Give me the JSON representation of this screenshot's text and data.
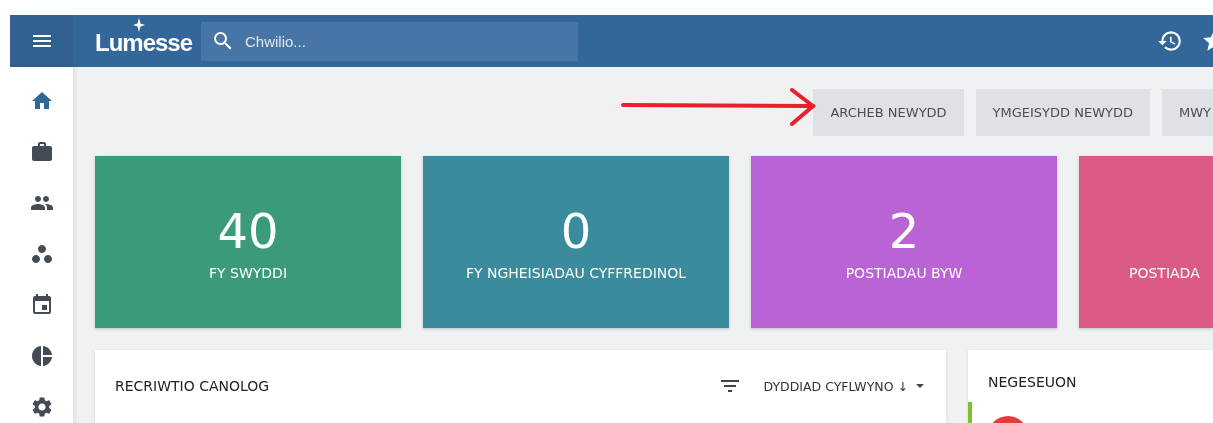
{
  "top_bar": {
    "brand": "Lumesse",
    "search": {
      "placeholder": "Chwilio..."
    }
  },
  "sidebar": {
    "items": [
      {
        "selected": true
      },
      {
        "selected": false
      },
      {
        "selected": false
      },
      {
        "selected": false
      },
      {
        "selected": false
      },
      {
        "selected": false
      },
      {
        "selected": false
      }
    ]
  },
  "actions": [
    "ARCHEB NEWYDD",
    "YMGEISYDD NEWYDD",
    "MWY"
  ],
  "tiles": [
    {
      "value": "40",
      "label": "FY SWYDDI",
      "color": "#3a9a7a"
    },
    {
      "value": "0",
      "label": "FY NGHEISIADAU CYFFREDINOL",
      "color": "#3a8b9b"
    },
    {
      "value": "2",
      "label": "POSTIADAU BYW",
      "color": "#b963d4"
    },
    {
      "label": "POSTIADA",
      "color": "#dc5a86"
    }
  ],
  "panels": [
    {
      "title": "RECRIWTIO CANOLOG",
      "sort": "DYDDIAD CYFLWYNO ↓",
      "kind": "list"
    },
    {
      "title": "NEGESEUON",
      "kind": "messages"
    }
  ]
}
